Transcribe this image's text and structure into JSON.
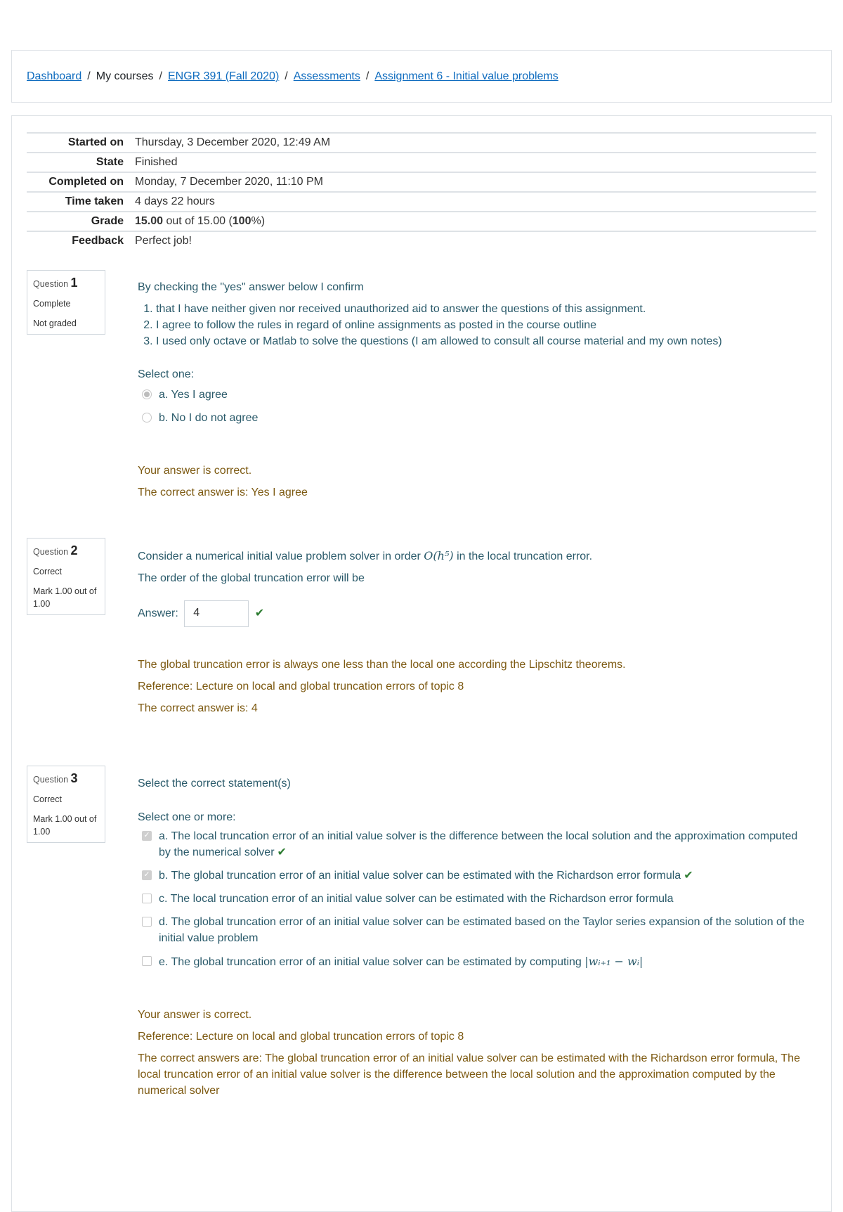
{
  "breadcrumb": {
    "items": [
      {
        "label": "Dashboard",
        "link": true
      },
      {
        "label": "My courses",
        "link": false
      },
      {
        "label": "ENGR 391 (Fall 2020)",
        "link": true
      },
      {
        "label": "Assessments",
        "link": true
      },
      {
        "label": "Assignment 6 - Initial value problems",
        "link": true
      }
    ],
    "separator": "/"
  },
  "summary": {
    "started_on": {
      "label": "Started on",
      "value": "Thursday, 3 December 2020, 12:49 AM"
    },
    "state": {
      "label": "State",
      "value": "Finished"
    },
    "completed_on": {
      "label": "Completed on",
      "value": "Monday, 7 December 2020, 11:10 PM"
    },
    "time_taken": {
      "label": "Time taken",
      "value": "4 days 22 hours"
    },
    "grade": {
      "label": "Grade",
      "score": "15.00",
      "out_of": " out of 15.00 (",
      "percent": "100",
      "suffix": "%)"
    },
    "feedback": {
      "label": "Feedback",
      "value": "Perfect job!"
    }
  },
  "questions": [
    {
      "label": "Question",
      "number": "1",
      "status": "Complete",
      "mark": "Not graded",
      "text": "By checking the \"yes\" answer below I confirm",
      "list": [
        "that I have neither given nor received unauthorized aid to answer the questions of this assignment.",
        "I agree to follow the rules in regard of online assignments as posted in the course outline",
        "I used only octave or Matlab to solve the questions (I am allowed to consult all course material and my own notes)"
      ],
      "prompt": "Select one:",
      "options": [
        {
          "label": "a. Yes I agree",
          "selected": true
        },
        {
          "label": "b. No I do not agree",
          "selected": false
        }
      ],
      "feedback": [
        "Your answer is correct.",
        "The correct answer is: Yes I agree"
      ]
    },
    {
      "label": "Question",
      "number": "2",
      "status": "Correct",
      "mark": "Mark 1.00 out of 1.00",
      "text_before": "Consider a numerical initial value problem solver in order ",
      "math": "O(h⁵)",
      "text_after": " in the local truncation error.",
      "text2": "The order of the global truncation error will be",
      "answer_label": "Answer:",
      "answer_value": "4",
      "feedback": [
        "The global truncation error is always one less than the local one according the Lipschitz theorems.",
        "Reference: Lecture on local and global truncation errors of topic 8",
        "The correct answer is: 4"
      ]
    },
    {
      "label": "Question",
      "number": "3",
      "status": "Correct",
      "mark": "Mark 1.00 out of 1.00",
      "text": "Select the correct statement(s)",
      "prompt": "Select one or more:",
      "options": [
        {
          "label": "a. The local truncation error of an initial value solver is the difference between the local solution and the approximation computed by the numerical solver",
          "checked": true,
          "correct": true
        },
        {
          "label": "b. The global truncation error of an initial value solver can be estimated with the Richardson error formula",
          "checked": true,
          "correct": true
        },
        {
          "label": "c. The local truncation error of an initial value solver can be estimated with the Richardson error formula",
          "checked": false,
          "correct": false
        },
        {
          "label": "d. The global truncation error of an initial value solver can be estimated based on the Taylor series expansion of the solution of the initial value problem",
          "checked": false,
          "correct": false
        },
        {
          "label": "e. The global truncation error of an initial value solver can be estimated by computing ",
          "math": "|wᵢ₊₁ − wᵢ|",
          "checked": false,
          "correct": false
        }
      ],
      "feedback": [
        "Your answer is correct.",
        "Reference: Lecture on local and global truncation errors of topic 8",
        "The correct answers are: The global truncation error of an initial value solver can be estimated with the Richardson error formula, The local truncation error of an initial value solver is the difference between the local solution and the approximation computed by the numerical solver"
      ]
    }
  ],
  "icons": {
    "tick": "✔",
    "check": "✓"
  }
}
